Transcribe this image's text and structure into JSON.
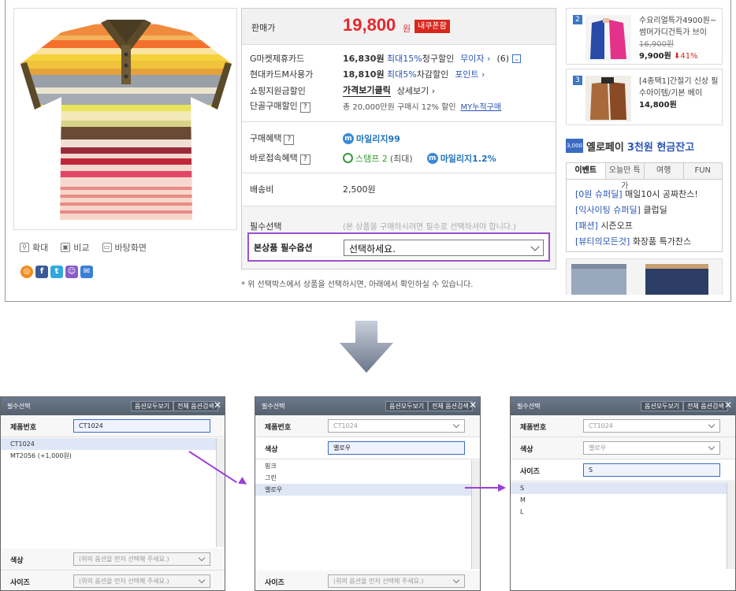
{
  "product": {
    "price_label": "판매가",
    "price": "19,800",
    "price_unit": "원",
    "coupon_badge": "내쿠폰함",
    "tools": [
      "확대",
      "비교",
      "바탕화면"
    ],
    "rows": [
      {
        "label": "G마켓제휴카드",
        "value": "16,830원",
        "extra": "최대15%",
        "extra2": "청구할인",
        "link": "무이자",
        "count": "(6)"
      },
      {
        "label": "현대카드M사용가",
        "value": "18,810원",
        "extra": "최대5%",
        "extra2": "차감할인",
        "link": "포인트"
      },
      {
        "label": "쇼핑지원금할인",
        "value": "가격보기클릭",
        "link": "상세보기"
      },
      {
        "label": "단골구매할인",
        "value": "총 20,000만원 구매시 12% 할인",
        "link": "MY누적구매"
      }
    ],
    "benefit_label": "구매혜택",
    "benefit_mileage": "마일리지99",
    "direct_label": "바로접속혜택",
    "direct_stamp": "스탬프 2",
    "direct_stamp_note": "(최대)",
    "direct_mileage": "마일리지1.2%",
    "shipping_label": "배송비",
    "shipping_value": "2,500원",
    "required_label": "필수선택",
    "required_note": "(본 상품을 구매하시려면 필수로 선택하셔야 합니다.)",
    "option_label": "본상품 필수옵션",
    "option_select": "선택하세요.",
    "footnote": "* 위 선택박스에서 상품을 선택하시면, 아래에서 확인하실 수 있습니다."
  },
  "sidebar": {
    "ranks": [
      {
        "num": "2",
        "title": "수요리얼특가4900원~ 썸머가디건특가 브이",
        "old_price": "16,900원",
        "price": "9,900원",
        "discount": "41%"
      },
      {
        "num": "3",
        "title": "[4종택1]간절기 신상 필수아이템/기본 베이",
        "price": "14,800원"
      }
    ],
    "banner_badge": "3,000",
    "banner_text": "옐로페이",
    "banner_highlight": "3천원 현금잔고",
    "tabs": [
      "이벤트",
      "오늘만 특가",
      "여행",
      "FUN"
    ],
    "events": [
      {
        "tag": "[0원 슈퍼딜]",
        "text": "매일10시 공짜찬스!"
      },
      {
        "tag": "[익사이팅 슈퍼딜]",
        "text": "클럽딜"
      },
      {
        "tag": "[패션]",
        "text": "시즌오프"
      },
      {
        "tag": "[뷰티의모든것]",
        "text": "화장품 특가찬스"
      }
    ]
  },
  "panels": [
    {
      "title": "필수선택",
      "btn1": "옵션모두보기",
      "btn2": "전체 옵션검색",
      "row1_label": "제품번호",
      "row1_value": "CT1024",
      "items": [
        "CT1024",
        "MT2056 (+1,000원)"
      ],
      "row2_label": "색상",
      "row2_value": "(위의 옵션을 먼저 선택해 주세요.)",
      "row3_label": "사이즈",
      "row3_value": "(위의 옵션을 먼저 선택해 주세요.)"
    },
    {
      "title": "필수선택",
      "btn1": "옵션모두보기",
      "btn2": "전체 옵션검색",
      "row1_label": "제품번호",
      "row1_value": "CT1024",
      "row2_label": "색상",
      "row2_value": "옐로우",
      "items": [
        "핑크",
        "그린",
        "옐로우"
      ],
      "row3_label": "사이즈",
      "row3_value": "(위의 옵션을 먼저 선택해 주세요.)"
    },
    {
      "title": "필수선택",
      "btn1": "옵션모두보기",
      "btn2": "전체 옵션검색",
      "row1_label": "제품번호",
      "row1_value": "CT1024",
      "row2_label": "색상",
      "row2_value": "옐로우",
      "row3_label": "사이즈",
      "row3_value": "S",
      "items": [
        "S",
        "M",
        "L"
      ]
    }
  ]
}
